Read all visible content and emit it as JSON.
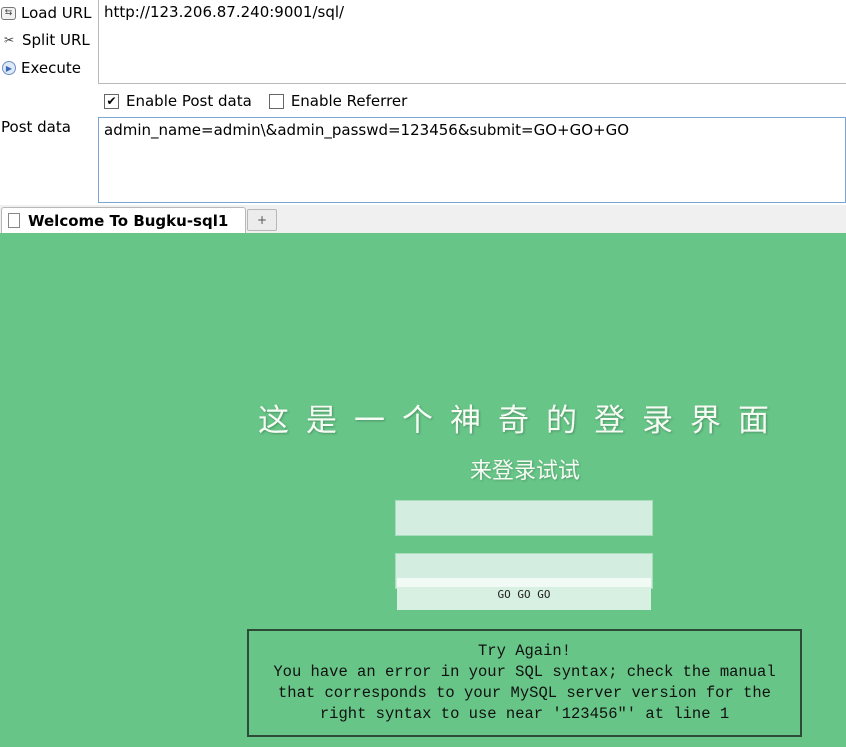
{
  "toolbar": {
    "load_url": "Load URL",
    "split_url": "Split URL",
    "execute": "Execute",
    "url_value": "http://123.206.87.240:9001/sql/",
    "enable_post": "Enable Post data",
    "enable_post_checked": true,
    "enable_referrer": "Enable Referrer",
    "enable_referrer_checked": false,
    "post_label": "Post data",
    "post_value": "admin_name=admin\\&admin_passwd=123456&submit=GO+GO+GO"
  },
  "tabs": [
    {
      "label": "Welcome To Bugku-sql1"
    }
  ],
  "page": {
    "headline": "这是一个神奇的登录界面",
    "subline": "来登录试试",
    "button_label": "GO GO GO",
    "message_lines": [
      "Try Again!",
      "You have an error in your SQL syntax; check the manual",
      "that corresponds to your MySQL server version for the",
      "right syntax to use near '123456\"' at line 1"
    ],
    "background_color": "#67c587"
  },
  "icons": [
    "load-url-icon",
    "split-url-icon",
    "execute-icon",
    "page-icon",
    "new-tab-icon"
  ]
}
